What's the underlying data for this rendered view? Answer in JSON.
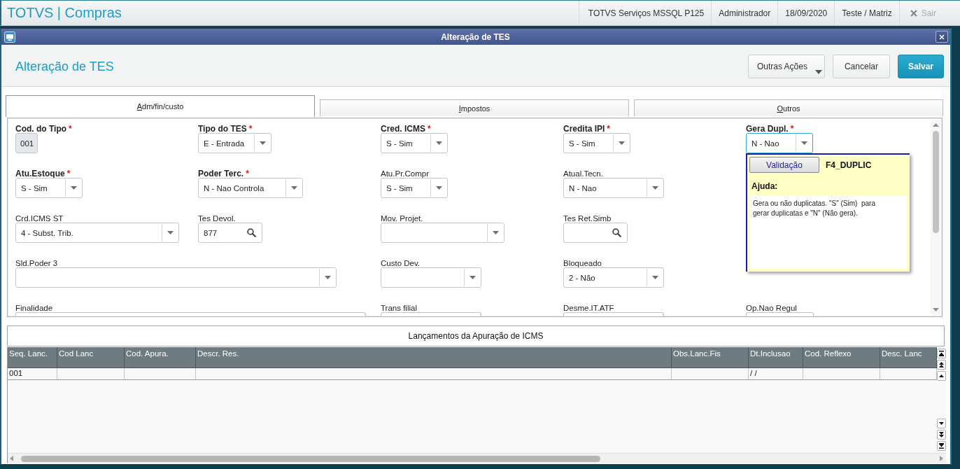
{
  "app_bar": {
    "title": "TOTVS | Compras",
    "info": [
      "TOTVS Serviços MSSQL P125",
      "Administrador",
      "18/09/2020",
      "Teste / Matriz"
    ],
    "logout": {
      "label": "Sair",
      "disabled": true
    }
  },
  "dialog": {
    "title": "Alteração de TES",
    "heading": "Alteração de TES",
    "actions": [
      {
        "label": "Outras Ações",
        "kind": "menu"
      },
      {
        "label": "Cancelar",
        "kind": "secondary"
      },
      {
        "label": "Salvar",
        "kind": "primary"
      }
    ]
  },
  "tabs": [
    {
      "label": "Adm/fin/custo",
      "selected": true
    },
    {
      "label": "Impostos",
      "selected": false
    },
    {
      "label": "Outros",
      "selected": false
    }
  ],
  "form": {
    "fields": [
      {
        "label": "Cod. do Tipo",
        "required": true,
        "required_mark": "*",
        "kind": "readonly",
        "value": "001",
        "focused": false
      },
      {
        "label": "Tipo do TES",
        "required": true,
        "required_mark": "*",
        "kind": "select",
        "value": "E - Entrada",
        "focused": false
      },
      {
        "label": "Cred. ICMS",
        "required": true,
        "required_mark": "*",
        "kind": "select",
        "value": "S - Sim",
        "focused": false
      },
      {
        "label": "Credita IPI",
        "required": true,
        "required_mark": "*",
        "kind": "select",
        "value": "S - Sim",
        "focused": false
      },
      {
        "label": "Gera Dupl.",
        "required": true,
        "required_mark": "*",
        "kind": "select",
        "value": "N - Nao",
        "focused": true
      },
      {
        "label": "Atu.Estoque",
        "required": true,
        "required_mark": "*",
        "kind": "select",
        "value": "S - Sim",
        "focused": false
      },
      {
        "label": "Poder Terc.",
        "required": true,
        "required_mark": "*",
        "kind": "select",
        "value": "N - Nao Controla",
        "focused": false
      },
      {
        "label": "Atu.Pr.Compr",
        "required": false,
        "kind": "select",
        "value": "S - Sim",
        "focused": false
      },
      {
        "label": "Atual.Tecn.",
        "required": false,
        "kind": "select",
        "value": "N - Nao",
        "focused": false
      },
      {
        "label": "Crd.ICMS ST",
        "required": false,
        "kind": "select",
        "value": "4 - Subst. Trib.",
        "focused": false
      },
      {
        "label": "Tes Devol.",
        "required": false,
        "kind": "lookup",
        "value": "877",
        "focused": false
      },
      {
        "label": "Mov. Projet.",
        "required": false,
        "kind": "select",
        "focused": false
      },
      {
        "label": "Tes Ret.Simb",
        "required": false,
        "kind": "lookup",
        "focused": false
      },
      {
        "label": "Sld.Poder 3",
        "required": false,
        "kind": "select",
        "focused": false
      },
      {
        "label": "Custo Dev.",
        "required": false,
        "kind": "select",
        "focused": false
      },
      {
        "label": "Bloqueado",
        "required": false,
        "kind": "select",
        "value": "2 - Não",
        "focused": false
      },
      {
        "label": "Finalidade",
        "required": false,
        "kind": "select",
        "focused": false
      },
      {
        "label": "Trans filial",
        "required": false,
        "kind": "select",
        "focused": false
      },
      {
        "label": "Desme.IT.ATF",
        "required": false,
        "kind": "select",
        "focused": false
      },
      {
        "label": "Op.Nao Regul",
        "required": false,
        "kind": "text",
        "focused": false
      }
    ],
    "help_popup": {
      "button": "Validação",
      "code": "F4_DUPLIC",
      "heading": "Ajuda:",
      "text": "Gera ou não duplicatas. \"S\" (Sim)  para gerar duplicatas e \"N\" (Não gera)."
    }
  },
  "lancamentos": {
    "title": "Lançamentos da Apuração de ICMS",
    "columns": [
      "Seq. Lanc.",
      "Cod Lanc",
      "Cod. Apura.",
      "Descr. Res.",
      "Obs.Lanc.Fis",
      "Dt.Inclusao",
      "Cod. Reflexo",
      "Desc. Lanc"
    ],
    "rows": [
      {
        "cells": [
          "001",
          null,
          null,
          null,
          null,
          "/ /",
          null,
          null
        ]
      }
    ]
  }
}
